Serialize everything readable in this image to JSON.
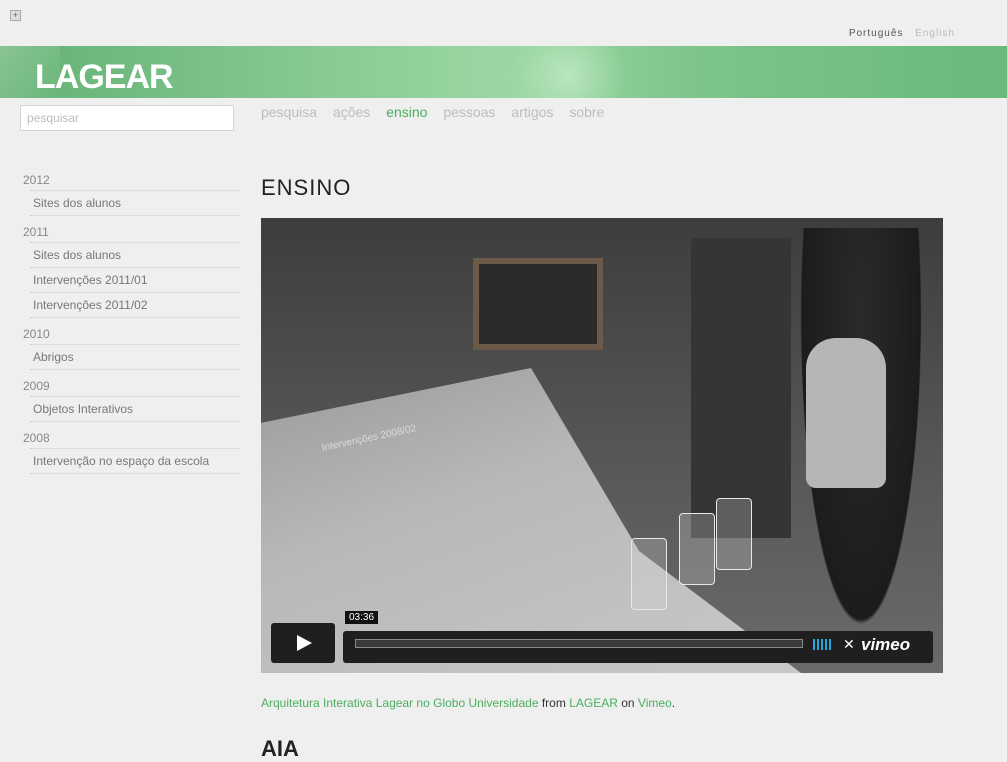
{
  "languages": {
    "active": "Português",
    "inactive": "English"
  },
  "logo": "LAGEAR",
  "search": {
    "placeholder": "pesquisar"
  },
  "nav": [
    "pesquisa",
    "ações",
    "ensino",
    "pessoas",
    "artigos",
    "sobre"
  ],
  "nav_active": "ensino",
  "sidebar": [
    {
      "year": "2012",
      "items": [
        "Sites dos alunos"
      ]
    },
    {
      "year": "2011",
      "items": [
        "Sites dos alunos",
        "Intervenções 2011/01",
        "Intervenções 2011/02"
      ]
    },
    {
      "year": "2010",
      "items": [
        "Abrigos"
      ]
    },
    {
      "year": "2009",
      "items": [
        "Objetos Interativos"
      ]
    },
    {
      "year": "2008",
      "items": [
        "Intervenção no espaço da escola"
      ]
    }
  ],
  "page_title": "ENSINO",
  "video": {
    "duration": "03:36",
    "projected_text": "Intervenções 2008/02",
    "player_brand": "vimeo"
  },
  "caption": {
    "title_link": "Arquitetura Interativa Lagear no Globo Universidade",
    "from": "from",
    "author_link": "LAGEAR",
    "on": "on",
    "site_link": "Vimeo",
    "period": "."
  },
  "subheading": "AIA",
  "colors": {
    "accent": "#4aae5e",
    "banner": "#86c891"
  }
}
